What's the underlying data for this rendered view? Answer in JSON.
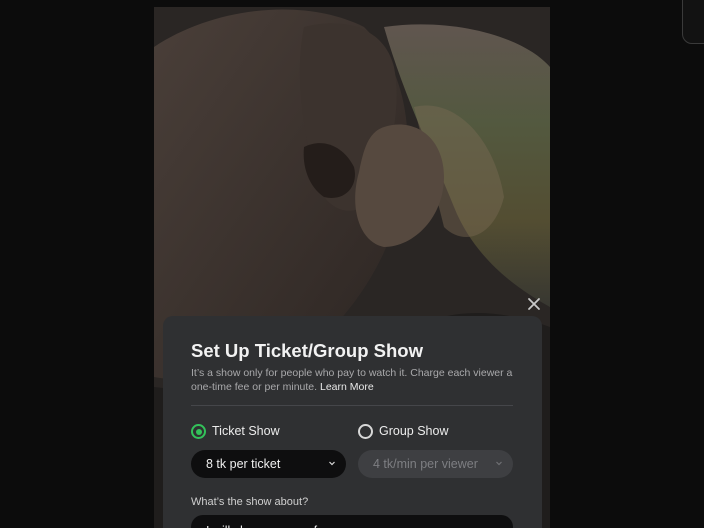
{
  "modal": {
    "title": "Set Up Ticket/Group Show",
    "description": "It’s a show only for people who pay to watch it. Charge each viewer a one-time fee or per minute.",
    "learn_more": "Learn More",
    "options": {
      "ticket": {
        "label": "Ticket Show",
        "selected": true,
        "price": "8 tk per ticket"
      },
      "group": {
        "label": "Group Show",
        "selected": false,
        "price": "4 tk/min per viewer"
      }
    },
    "about_label": "What’s the show about?",
    "about_value": "I will show my cum for you"
  },
  "colors": {
    "accent_green": "#33c25a",
    "modal_bg": "#2f3032",
    "page_bg": "#0c0c0c"
  },
  "icons": {
    "close": "close-icon",
    "chevron": "chevron-down-icon"
  }
}
